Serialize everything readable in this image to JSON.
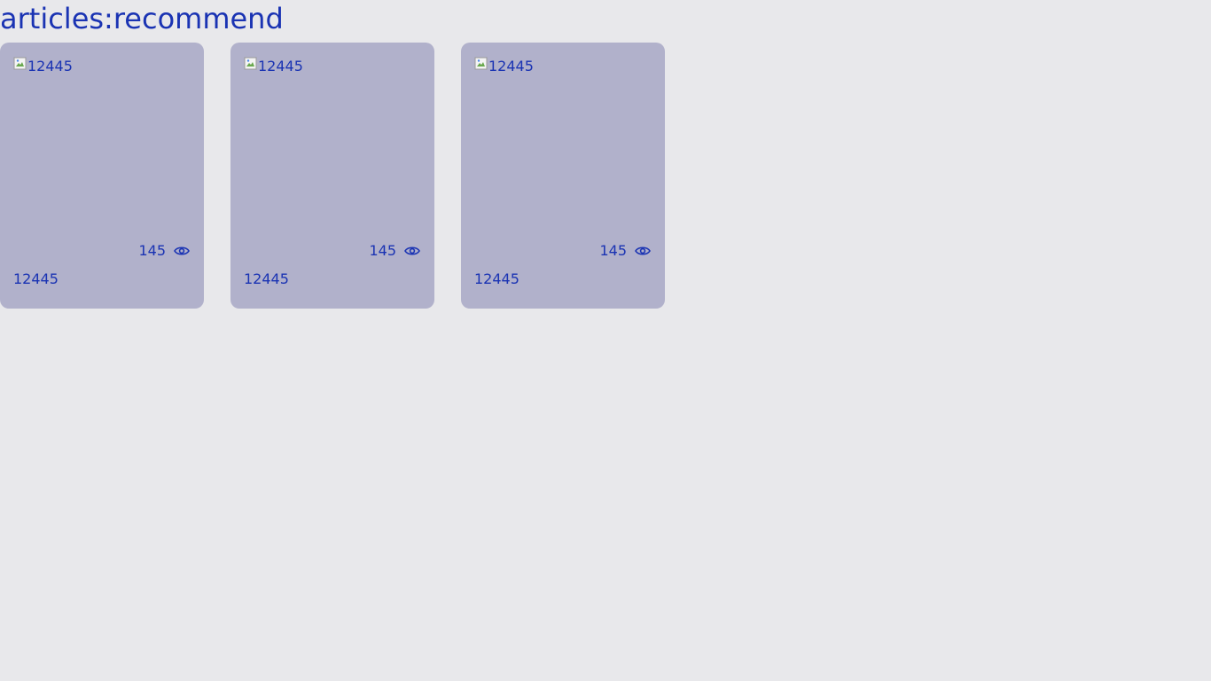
{
  "page": {
    "heading": "articles:recommend"
  },
  "cards": [
    {
      "image_alt": "12445",
      "views": "145",
      "title": "12445"
    },
    {
      "image_alt": "12445",
      "views": "145",
      "title": "12445"
    },
    {
      "image_alt": "12445",
      "views": "145",
      "title": "12445"
    }
  ],
  "icons": {
    "views": "eye-icon",
    "image": "broken-image-icon"
  },
  "colors": {
    "background": "#e8e8eb",
    "card": "#b1b1cb",
    "text": "#1a33b3"
  }
}
